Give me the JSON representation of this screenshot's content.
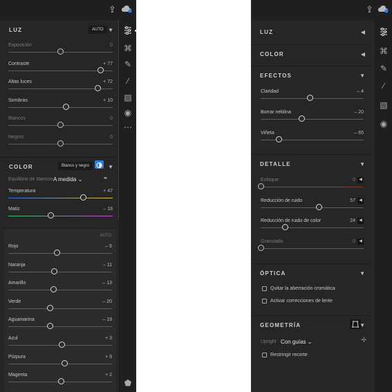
{
  "left": {
    "luz": {
      "title": "LUZ",
      "auto": "AUTO",
      "sliders": [
        {
          "label": "Exposición",
          "value": "0",
          "pos": 0.5,
          "dim": true
        },
        {
          "label": "Contraste",
          "value": "+ 77",
          "pos": 0.885,
          "dim": false
        },
        {
          "label": "Altas luces",
          "value": "+ 72",
          "pos": 0.86,
          "dim": false
        },
        {
          "label": "Sombras",
          "value": "+ 10",
          "pos": 0.55,
          "dim": false
        },
        {
          "label": "Blancos",
          "value": "0",
          "pos": 0.5,
          "dim": true
        },
        {
          "label": "Negros",
          "value": "0",
          "pos": 0.5,
          "dim": true
        }
      ]
    },
    "color": {
      "title": "COLOR",
      "bw_label": "Blanco y negro",
      "wb_label": "Equilibrio de blancos",
      "wb_value": "A medida",
      "sliders": [
        {
          "label": "Temperatura",
          "value": "+ 47",
          "pos": 0.72,
          "dim": false
        },
        {
          "label": "Matiz",
          "value": "– 18",
          "pos": 0.41,
          "dim": false
        }
      ]
    },
    "hsl": {
      "auto": "AUTO",
      "sliders": [
        {
          "label": "Rojo",
          "value": "– 6",
          "pos": 0.47,
          "dim": false
        },
        {
          "label": "Naranja",
          "value": "– 11",
          "pos": 0.445,
          "dim": false
        },
        {
          "label": "Amarillo",
          "value": "– 13",
          "pos": 0.435,
          "dim": false
        },
        {
          "label": "Verde",
          "value": "– 20",
          "pos": 0.4,
          "dim": false
        },
        {
          "label": "Aguamarina",
          "value": "– 19",
          "pos": 0.405,
          "dim": false
        },
        {
          "label": "Azul",
          "value": "+ 3",
          "pos": 0.515,
          "dim": false
        },
        {
          "label": "Púrpura",
          "value": "+ 9",
          "pos": 0.545,
          "dim": false
        },
        {
          "label": "Magenta",
          "value": "+ 2",
          "pos": 0.51,
          "dim": false
        }
      ]
    }
  },
  "right": {
    "luz": {
      "title": "LUZ"
    },
    "color": {
      "title": "COLOR"
    },
    "efectos": {
      "title": "EFECTOS",
      "sliders": [
        {
          "label": "Claridad",
          "value": "– 4",
          "pos": 0.48,
          "dim": false
        },
        {
          "label": "Borrar neblina",
          "value": "– 20",
          "pos": 0.4,
          "dim": false
        },
        {
          "label": "Viñeta",
          "value": "– 65",
          "pos": 0.175,
          "dim": false
        }
      ]
    },
    "detalle": {
      "title": "DETALLE",
      "sliders": [
        {
          "label": "Enfoque",
          "value": "0",
          "pos": 0.0,
          "dim": true
        },
        {
          "label": "Reducción de ruido",
          "value": "57",
          "pos": 0.57,
          "dim": false
        },
        {
          "label": "Reducción de ruido de color",
          "value": "24",
          "pos": 0.24,
          "dim": false
        },
        {
          "label": "Granulado",
          "value": "0",
          "pos": 0.0,
          "dim": true
        }
      ]
    },
    "optica": {
      "title": "ÓPTICA",
      "chromatic": "Quitar la aberración cromática",
      "lens": "Activar correcciones de lente"
    },
    "geometria": {
      "title": "GEOMETRÍA",
      "upright_label": "Upright",
      "upright_value": "Con guías",
      "restrict": "Restringir recorte"
    }
  },
  "icons": {
    "share": "share-icon",
    "cloud": "cloud-icon",
    "sliders": "edit-sliders-icon",
    "crop": "crop-icon",
    "healing": "healing-icon",
    "brush": "brush-icon",
    "gradient": "linear-gradient-icon",
    "radial": "radial-gradient-icon",
    "more": "more-icon",
    "tag": "tag-icon"
  },
  "colors": {
    "accent": "#2a7ce8",
    "panel": "#262626",
    "rail": "#1f1f1f"
  }
}
